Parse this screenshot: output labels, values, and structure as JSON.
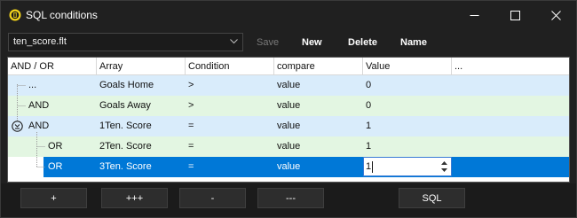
{
  "window": {
    "title": "SQL conditions"
  },
  "toolbar": {
    "file_select": {
      "value": "ten_score.flt"
    },
    "save_label": "Save",
    "new_label": "New",
    "delete_label": "Delete",
    "name_label": "Name"
  },
  "grid": {
    "headers": [
      "AND / OR",
      "Array",
      "Condition",
      "compare",
      "Value",
      "..."
    ],
    "rows": [
      {
        "andor": "...",
        "array": "Goals Home",
        "condition": ">",
        "compare": "value",
        "value": "0"
      },
      {
        "andor": "AND",
        "array": "Goals Away",
        "condition": ">",
        "compare": "value",
        "value": "0"
      },
      {
        "andor": "AND",
        "array": "1Ten. Score",
        "condition": "=",
        "compare": "value",
        "value": "1"
      },
      {
        "andor": "OR",
        "array": "2Ten. Score",
        "condition": "=",
        "compare": "value",
        "value": "1"
      },
      {
        "andor": "OR",
        "array": "3Ten. Score",
        "condition": "=",
        "compare": "value",
        "value": "1"
      }
    ]
  },
  "bottom": {
    "add_label": "+",
    "add_many_label": "+++",
    "remove_label": "-",
    "remove_many_label": "---",
    "sql_label": "SQL"
  }
}
